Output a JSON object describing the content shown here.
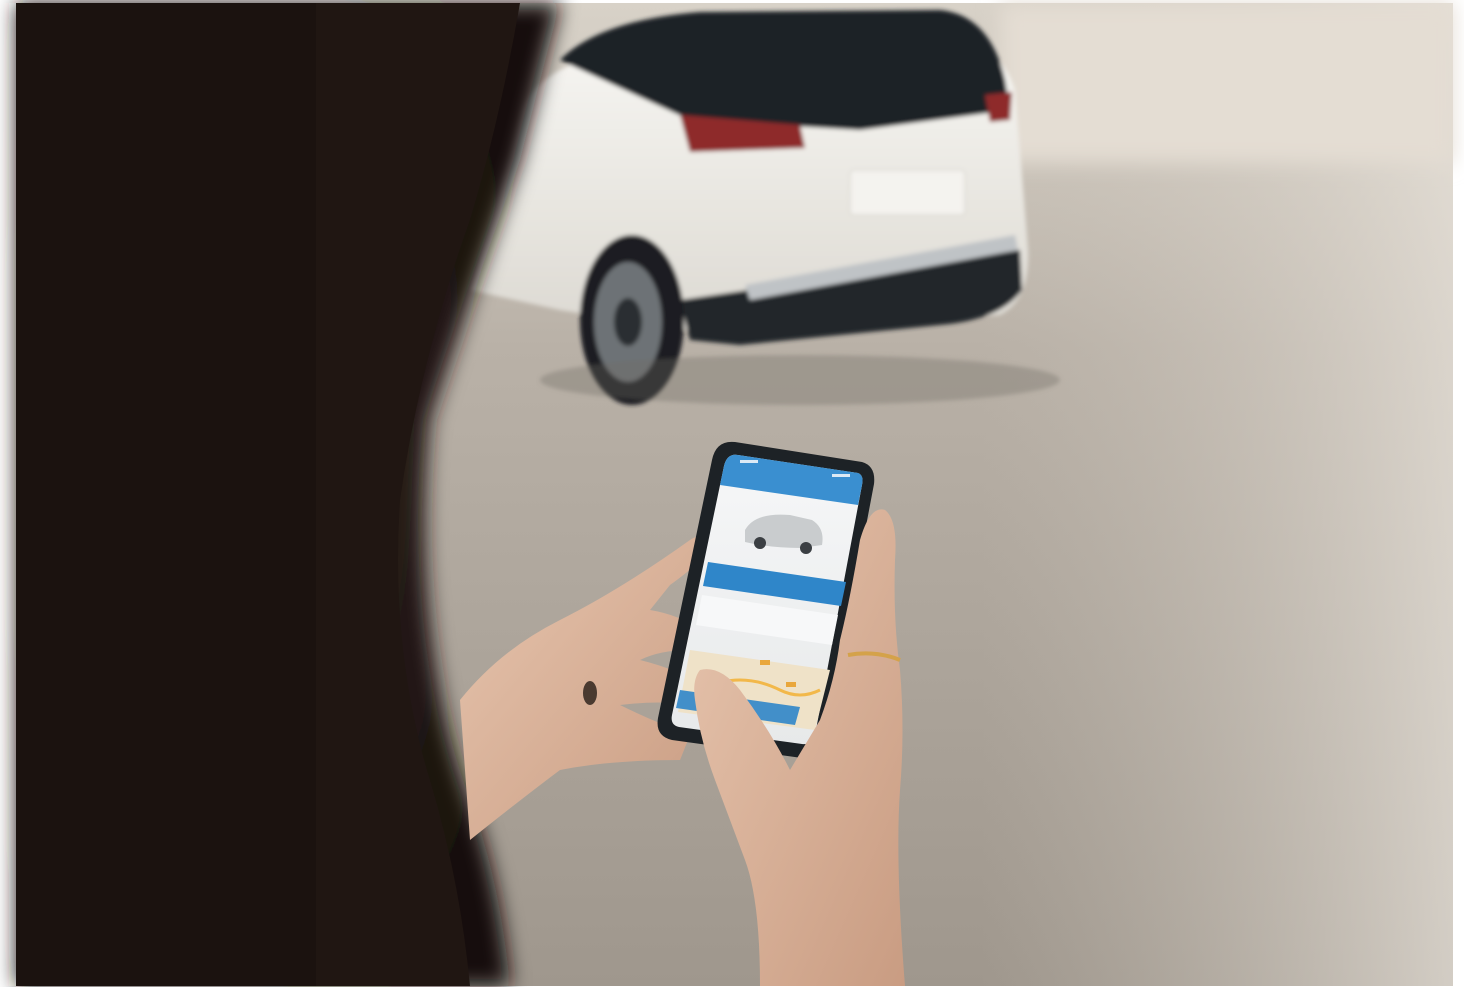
{
  "scene": {
    "description_colors": {
      "ground": "#aaa39b",
      "ground_light": "#c8c1b8",
      "car_body": "#f1efea",
      "car_dark": "#1f2327",
      "taillight": "#8e2a2b",
      "hair": "#2a1e19",
      "skin": "#d9b49c",
      "phone_frame": "#1d2226",
      "app_blue": "#2f86c9",
      "app_header": "#3a8fd0",
      "map_beige": "#efe2c8",
      "white_border": "#ffffff"
    }
  },
  "phone": {
    "screen_icons": [
      "car-thumbnail-icon",
      "map-icon",
      "status-bar-icons"
    ]
  }
}
